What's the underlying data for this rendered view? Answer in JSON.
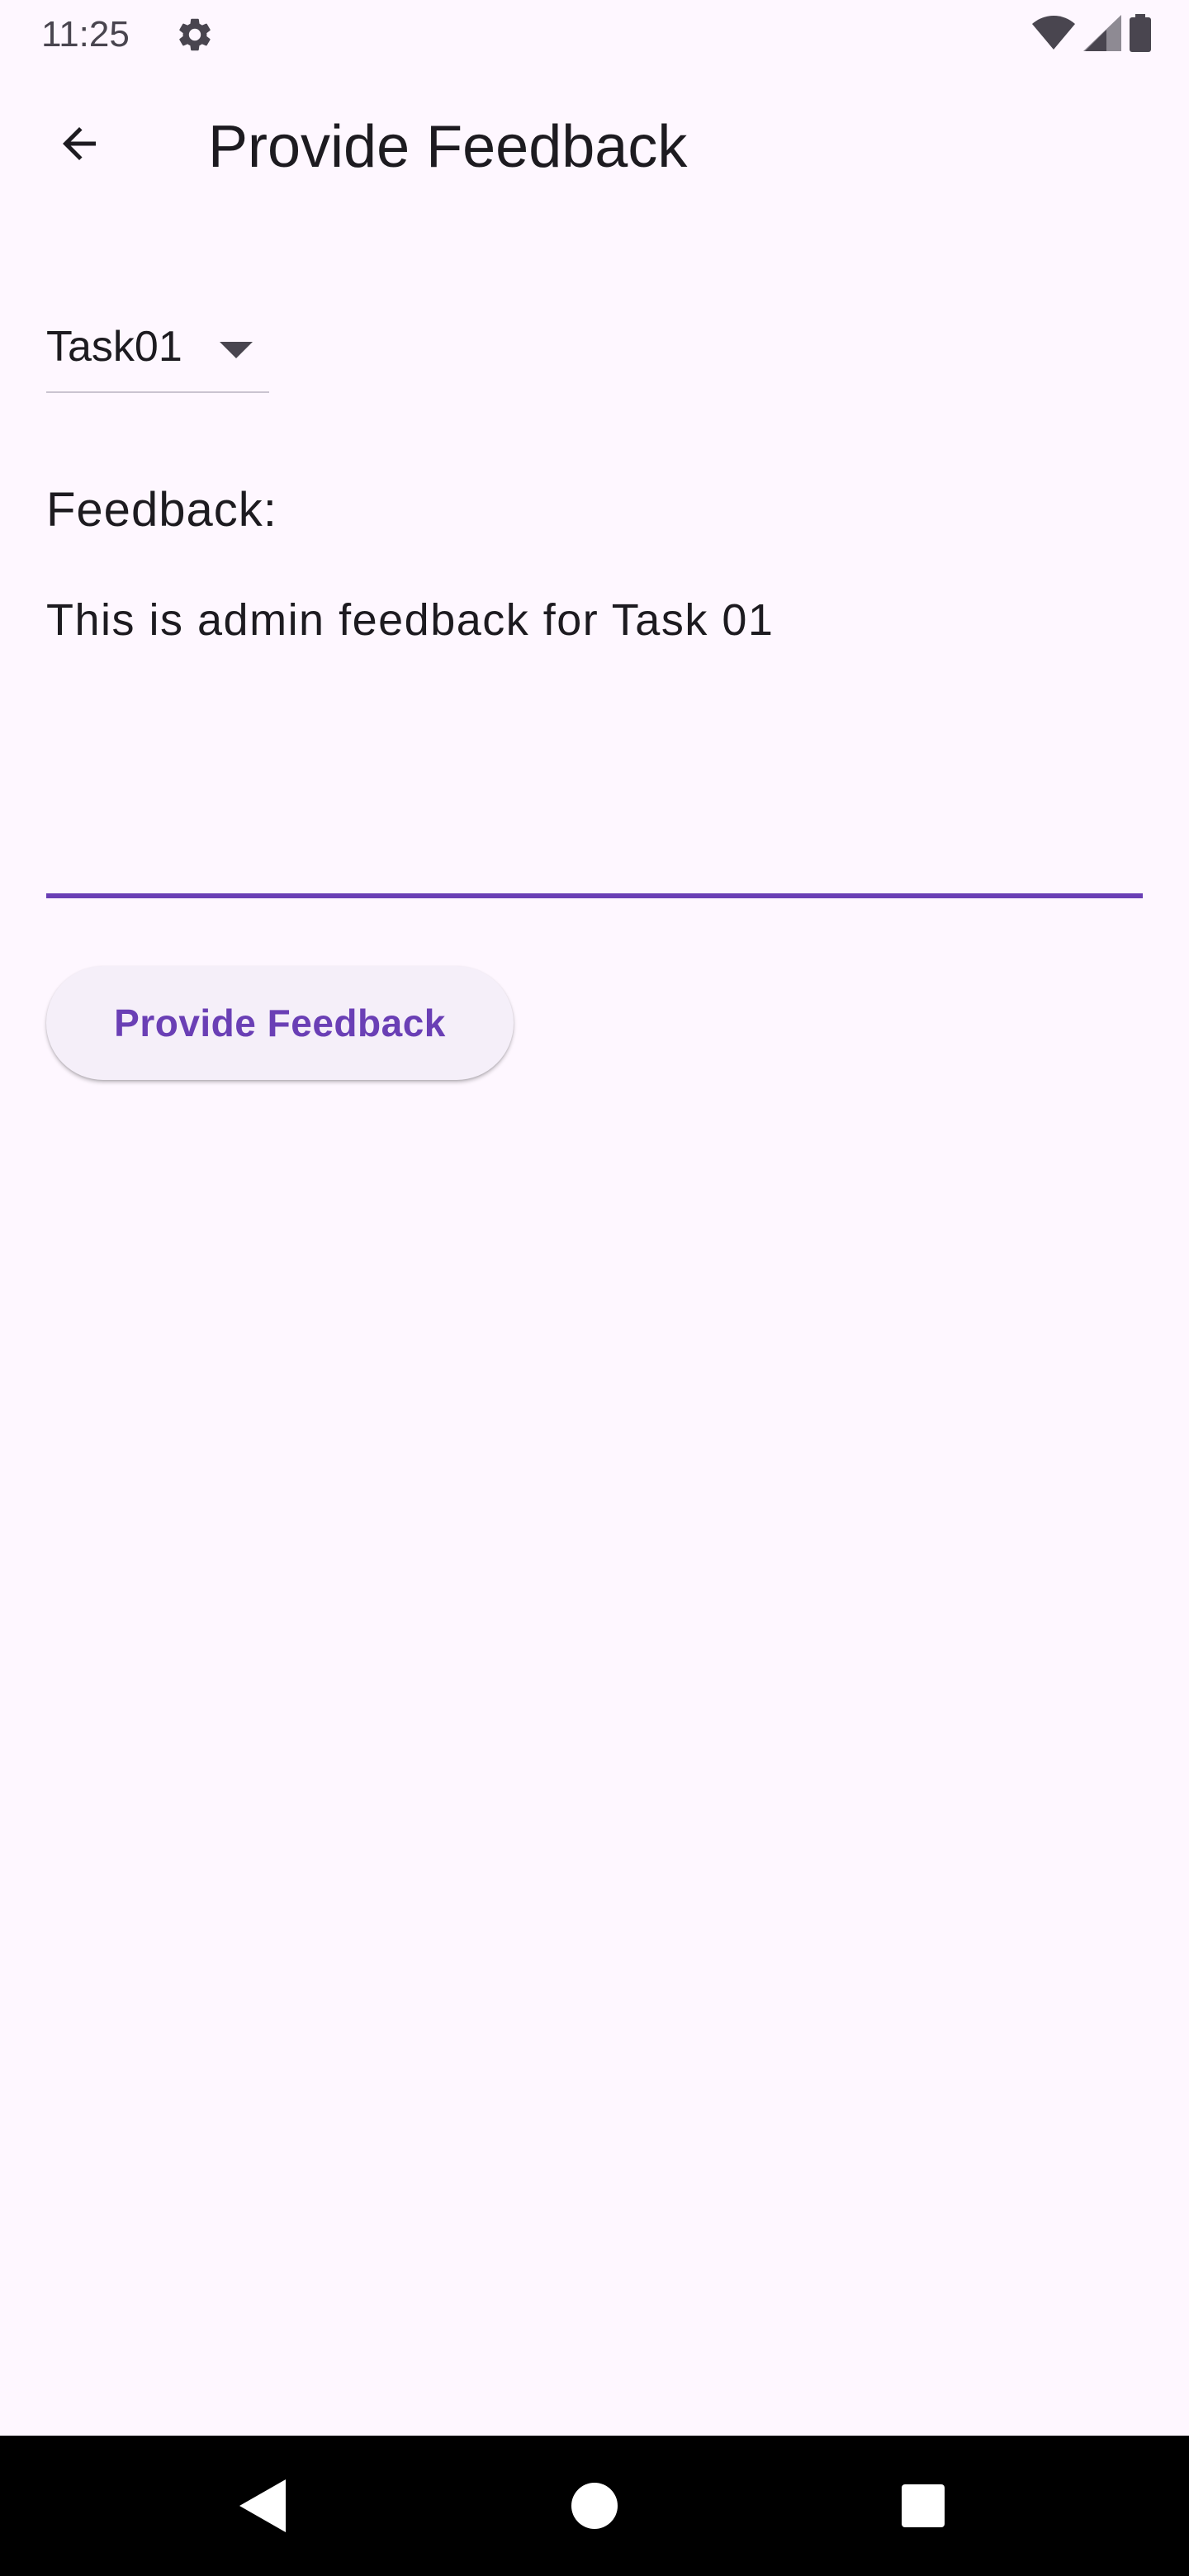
{
  "status_bar": {
    "time": "11:25",
    "icons": [
      "gear-icon",
      "wifi-icon",
      "cell-signal-icon",
      "battery-icon"
    ]
  },
  "app_bar": {
    "title": "Provide Feedback",
    "back_icon": "arrow-back-icon"
  },
  "task_dropdown": {
    "selected": "Task01",
    "icon": "dropdown-arrow-icon"
  },
  "feedback": {
    "label": "Feedback:",
    "value": "This is admin feedback for Task 01"
  },
  "submit_button": {
    "label": "Provide Feedback"
  },
  "nav_bar": {
    "icons": [
      "back-triangle-icon",
      "home-circle-icon",
      "recents-square-icon"
    ]
  },
  "colors": {
    "background": "#FEF7FF",
    "accent": "#6A3FB5",
    "text": "#1D1B20",
    "button_bg": "#F5EFF9",
    "nav_bar": "#000000"
  }
}
